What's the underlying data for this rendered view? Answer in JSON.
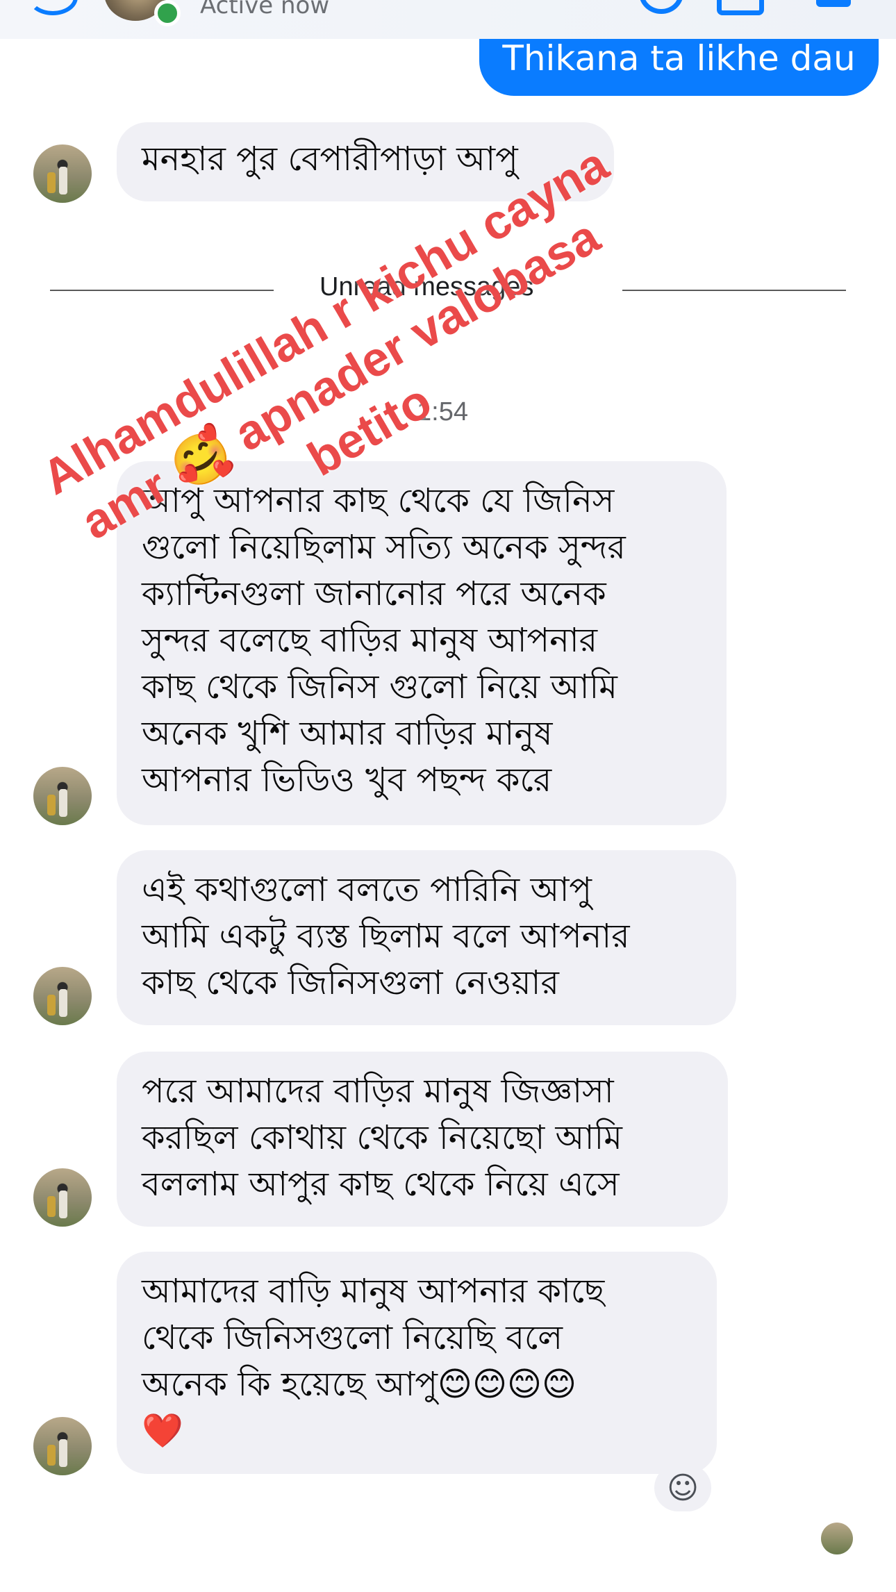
{
  "header": {
    "status_text": "Active now"
  },
  "outgoing_message": "Thikana ta likhe dau",
  "incoming_messages": [
    {
      "text": "মনহার পুর বেপারীপাড়া আপু"
    },
    {
      "lines": [
        "আপু আপনার কাছ থেকে যে জিনিস",
        "গুলো নিয়েছিলাম সত্যি অনেক সুন্দর",
        "ক্যান্টিনগুলা জানানোর পরে অনেক",
        "সুন্দর বলেছে বাড়ির মানুষ আপনার",
        "কাছ থেকে জিনিস গুলো নিয়ে আমি",
        "অনেক খুশি আমার বাড়ির মানুষ",
        "আপনার ভিডিও খুব পছন্দ করে"
      ]
    },
    {
      "lines": [
        "এই কথাগুলো বলতে পারিনি আপু",
        "আমি একটু ব্যস্ত ছিলাম বলে আপনার",
        "কাছ থেকে জিনিসগুলা নেওয়ার"
      ]
    },
    {
      "lines": [
        "পরে আমাদের বাড়ির মানুষ জিজ্ঞাসা",
        "করছিল কোথায় থেকে নিয়েছো আমি",
        "বললাম আপুর কাছ থেকে নিয়ে এসে"
      ]
    },
    {
      "lines": [
        "আমাদের বাড়ি মানুষ আপনার কাছে",
        "থেকে জিনিসগুলো নিয়েছি বলে",
        "অনেক কি হয়েছে  আপু😊😊😊😊",
        "❤️"
      ]
    }
  ],
  "unread_divider": "Unread messages",
  "timestamp": "1:54",
  "overlay_lines": [
    "Alhamdulillah r kichu cayna",
    "amr 🥰 apnader valobasa",
    "betito"
  ],
  "icons": {
    "back": "back-arrow-icon",
    "call": "phone-icon",
    "video": "video-camera-icon",
    "info": "info-icon",
    "react": "add-reaction-icon"
  },
  "colors": {
    "accent": "#0a7cff",
    "online": "#31a24c",
    "bubble_in": "#f0f0f5",
    "overlay_text": "#ea4a4a"
  }
}
